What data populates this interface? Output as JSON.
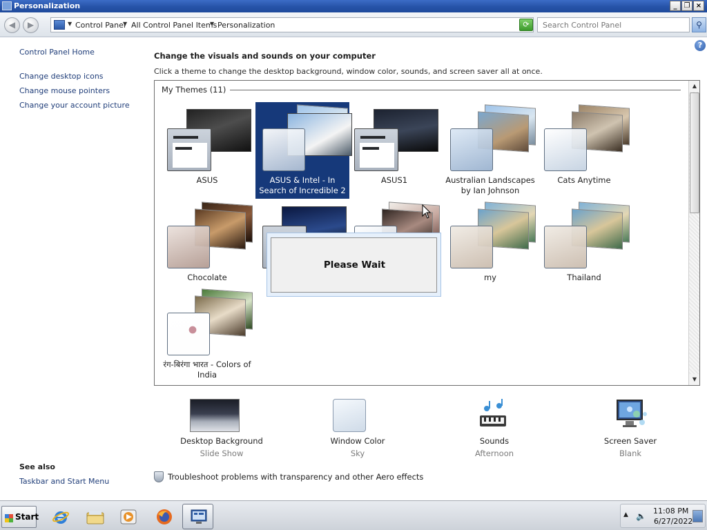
{
  "window": {
    "title": "Personalization"
  },
  "address": {
    "crumbs": [
      "Control Panel",
      "All Control Panel Items",
      "Personalization"
    ],
    "search_placeholder": "Search Control Panel"
  },
  "left_pane": {
    "home": "Control Panel Home",
    "links": [
      "Change desktop icons",
      "Change mouse pointers",
      "Change your account picture"
    ],
    "see_also_title": "See also",
    "see_also_links": [
      "Taskbar and Start Menu"
    ]
  },
  "main": {
    "heading": "Change the visuals and sounds on your computer",
    "subheading": "Click a theme to change the desktop background, window color, sounds, and screen saver all at once.",
    "group_title": "My Themes (11)",
    "themes": [
      {
        "name": "ASUS"
      },
      {
        "name": "ASUS & Intel - In Search of Incredible 2",
        "selected": true
      },
      {
        "name": "ASUS1"
      },
      {
        "name": "Australian Landscapes by Ian Johnson"
      },
      {
        "name": "Cats Anytime"
      },
      {
        "name": "Chocolate"
      },
      {
        "name": ""
      },
      {
        "name": ""
      },
      {
        "name": "my"
      },
      {
        "name": "Thailand"
      },
      {
        "name": "रंग-बिरंगा भारत - Colors of India"
      }
    ],
    "dialog_text": "Please Wait",
    "settings": [
      {
        "label": "Desktop Background",
        "value": "Slide Show",
        "icon": "desktop-background-icon"
      },
      {
        "label": "Window Color",
        "value": "Sky",
        "icon": "window-color-icon"
      },
      {
        "label": "Sounds",
        "value": "Afternoon",
        "icon": "sounds-icon"
      },
      {
        "label": "Screen Saver",
        "value": "Blank",
        "icon": "screen-saver-icon"
      }
    ],
    "troubleshoot": "Troubleshoot problems with transparency and other Aero effects"
  },
  "taskbar": {
    "start_label": "Start",
    "apps": [
      "internet-explorer-icon",
      "windows-explorer-icon",
      "media-player-icon",
      "firefox-icon",
      "control-panel-icon"
    ],
    "time": "11:08 PM",
    "date": "6/27/2022"
  }
}
